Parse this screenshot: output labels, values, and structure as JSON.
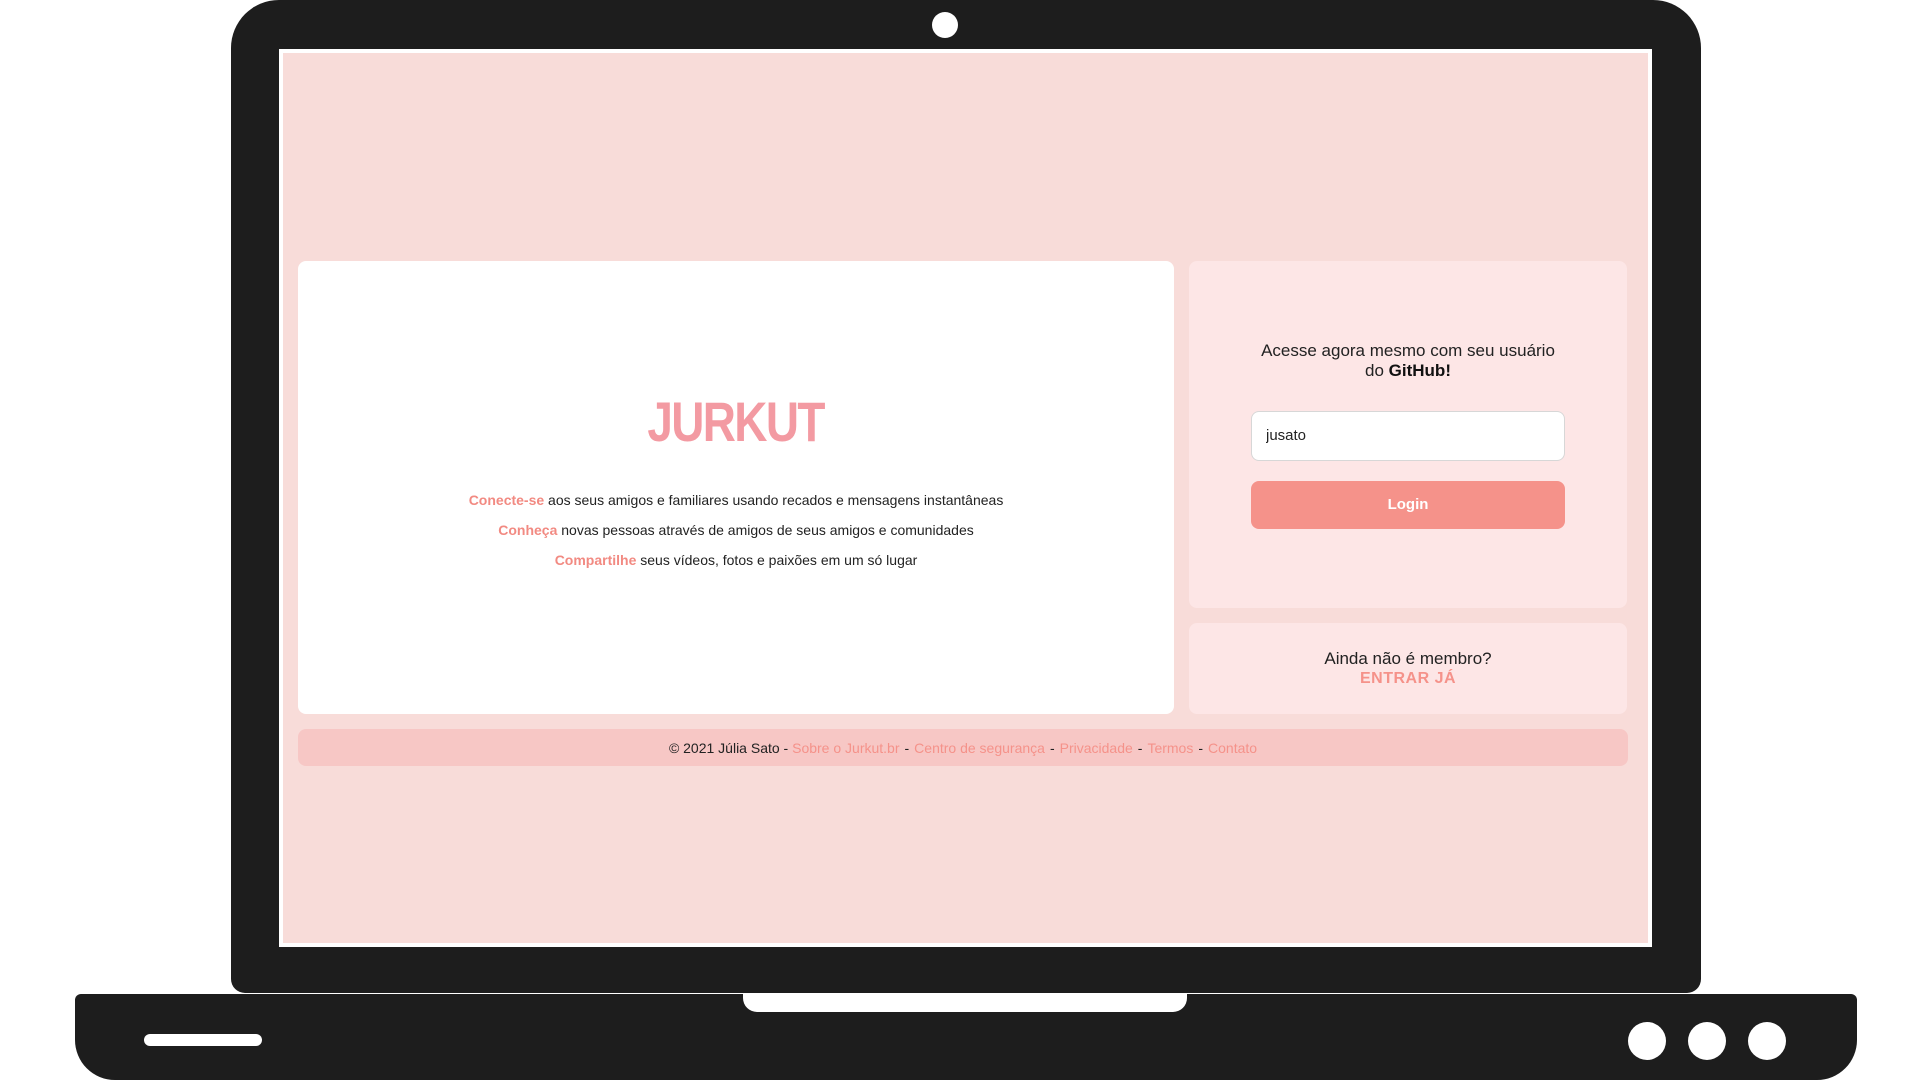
{
  "page": {
    "logo": "JURKUT",
    "taglines": [
      {
        "highlight": "Conecte-se",
        "text": " aos seus amigos e familiares usando recados e mensagens instantâneas"
      },
      {
        "highlight": "Conheça",
        "text": " novas pessoas através de amigos de seus amigos e comunidades"
      },
      {
        "highlight": "Compartilhe",
        "text": " seus vídeos, fotos e paixões em um só lugar"
      }
    ]
  },
  "login": {
    "text_before": "Acesse agora mesmo com seu usuário do ",
    "text_bold": "GitHub",
    "text_after": "!",
    "username_value": "jusato",
    "button_label": "Login"
  },
  "signup": {
    "question": "Ainda não é membro?",
    "link_label": "ENTRAR JÁ"
  },
  "footer": {
    "copyright": "© 2021 Júlia Sato -",
    "links": [
      "Sobre o Jurkut.br",
      "Centro de segurança",
      "Privacidade",
      "Termos",
      "Contato"
    ],
    "separator": "-"
  },
  "colors": {
    "page_background": "#f8dcd9",
    "accent": "#f5928a",
    "logo": "#f39aa2",
    "card_pink": "#fde6e6",
    "footer_bg": "#f7c7c5",
    "laptop_frame": "#1d1d1d"
  }
}
